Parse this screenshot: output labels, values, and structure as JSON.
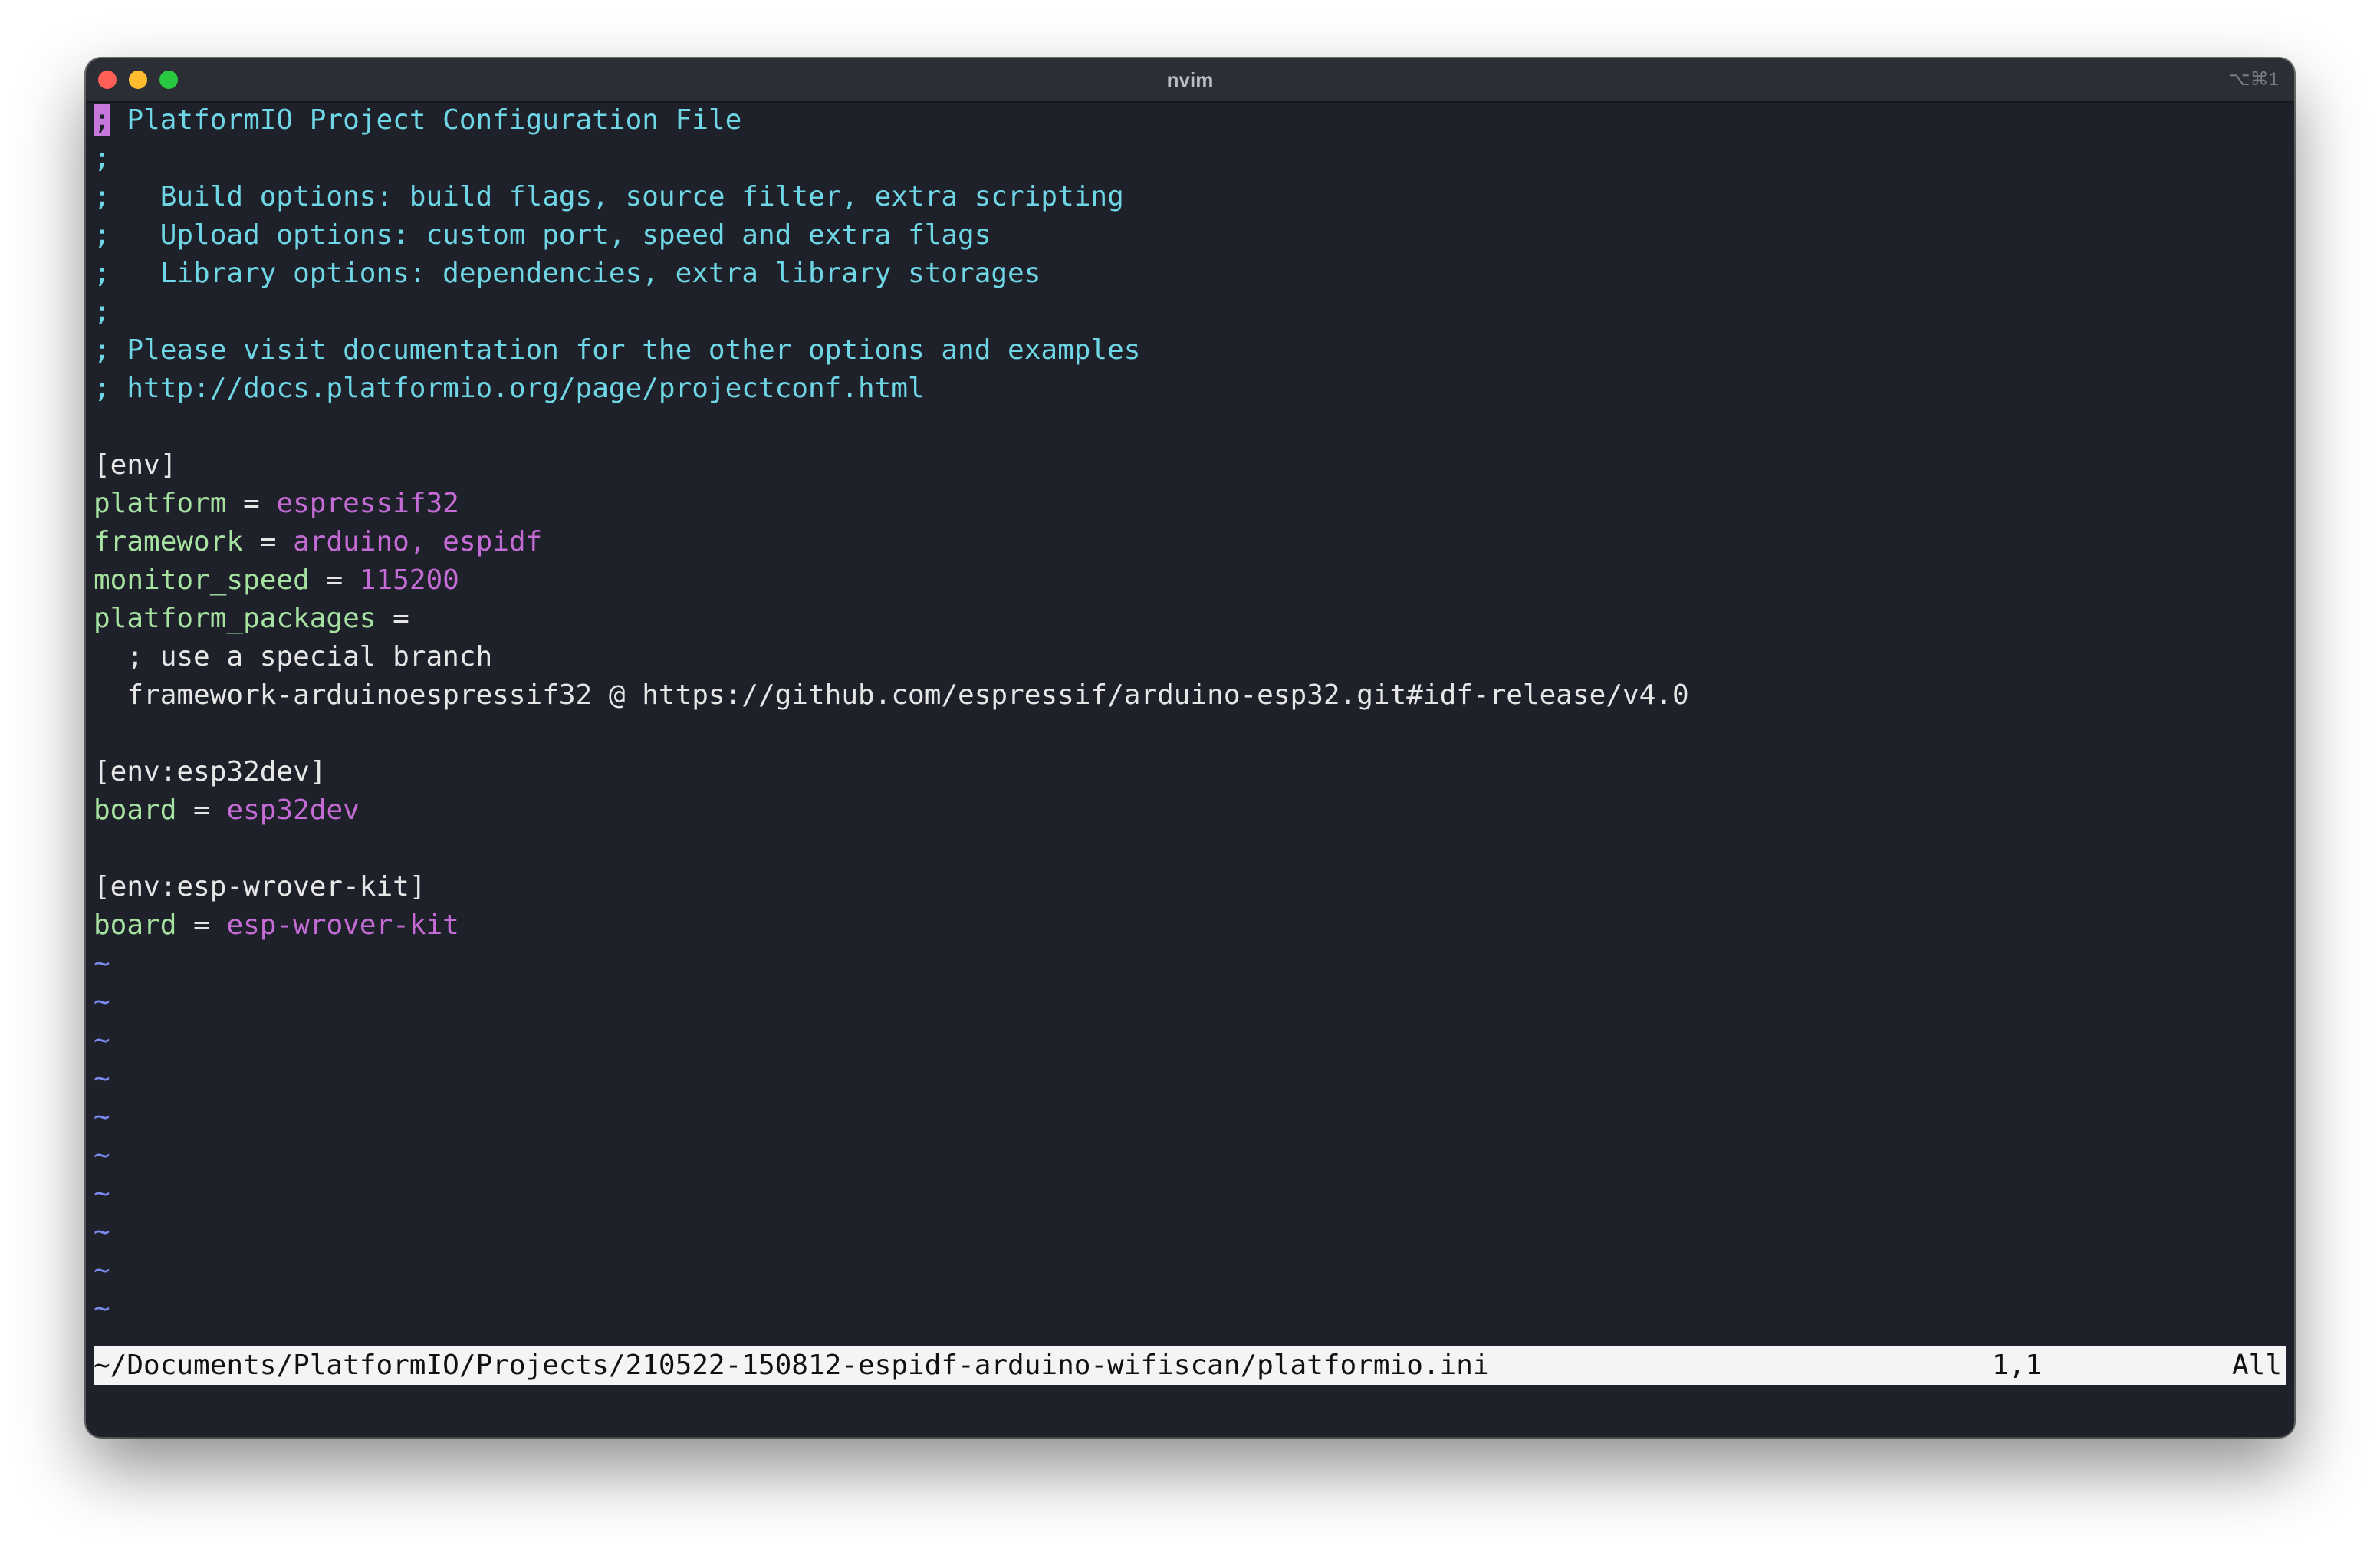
{
  "window": {
    "title": "nvim",
    "shortcut": "⌥⌘1"
  },
  "editor": {
    "lines": [
      {
        "cursor": ";",
        "rest": " PlatformIO Project Configuration File"
      },
      {
        "comment": ";"
      },
      {
        "comment": ";   Build options: build flags, source filter, extra scripting"
      },
      {
        "comment": ";   Upload options: custom port, speed and extra flags"
      },
      {
        "comment": ";   Library options: dependencies, extra library storages"
      },
      {
        "comment": ";"
      },
      {
        "comment": "; Please visit documentation for the other options and examples"
      },
      {
        "comment": "; http://docs.platformio.org/page/projectconf.html"
      },
      {
        "blank": ""
      },
      {
        "section": "[env]"
      },
      {
        "key": "platform",
        "op": " = ",
        "value": "espressif32"
      },
      {
        "key": "framework",
        "op": " = ",
        "value": "arduino, espidf"
      },
      {
        "key": "monitor_speed",
        "op": " = ",
        "value": "115200"
      },
      {
        "key": "platform_packages",
        "op": " ="
      },
      {
        "text": "  ; use a special branch"
      },
      {
        "text": "  framework-arduinoespressif32 @ https://github.com/espressif/arduino-esp32.git#idf-release/v4.0"
      },
      {
        "blank": ""
      },
      {
        "section": "[env:esp32dev]"
      },
      {
        "key": "board",
        "op": " = ",
        "value": "esp32dev"
      },
      {
        "blank": ""
      },
      {
        "section": "[env:esp-wrover-kit]"
      },
      {
        "key": "board",
        "op": " = ",
        "value": "esp-wrover-kit"
      }
    ],
    "tilde": "~"
  },
  "statusline": {
    "path": "~/Documents/PlatformIO/Projects/210522-150812-espidf-arduino-wifiscan/platformio.ini",
    "position": "1,1",
    "scroll": "All"
  }
}
